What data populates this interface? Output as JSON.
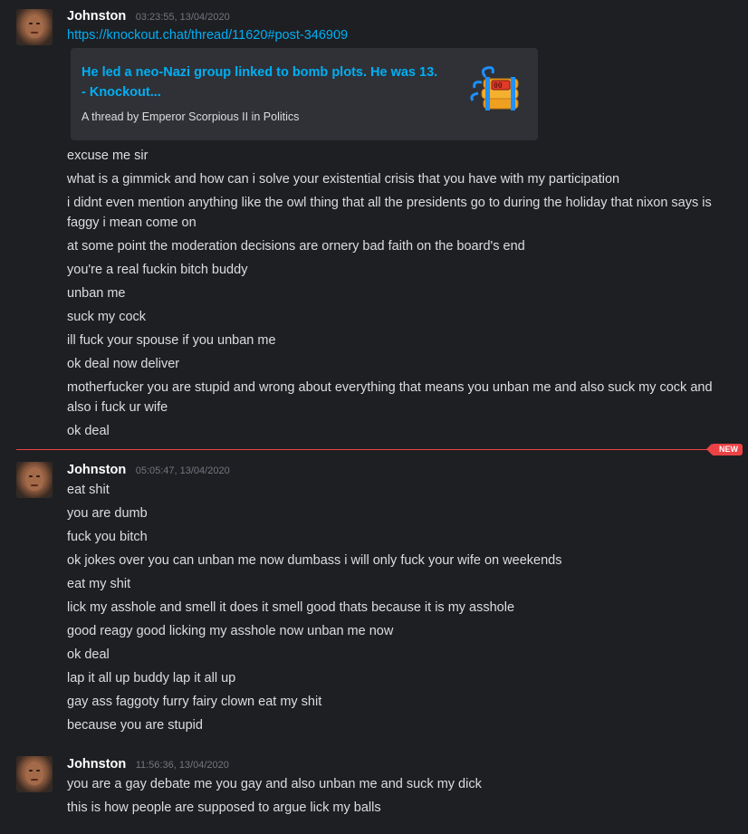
{
  "groups": [
    {
      "username": "Johnston",
      "timestamp": "03:23:55, 13/04/2020",
      "link": "https://knockout.chat/thread/11620#post-346909",
      "embed": {
        "title": "He led a neo-Nazi group linked to bomb plots. He was 13. - Knockout...",
        "description": "A thread by Emperor Scorpious II in Politics",
        "thumbnail_icon": "dynamite-icon"
      },
      "messages": [
        "excuse me sir",
        "what is a gimmick and how can i solve your existential crisis that you have with my participation",
        "i didnt even mention anything like the owl thing that all the presidents go to during the holiday that nixon says is faggy i mean come on",
        "at some point the moderation decisions are ornery bad faith on the board's end",
        "you're a real fuckin bitch buddy",
        "unban me",
        "suck my cock",
        "ill fuck your spouse if you unban me",
        "ok deal now deliver",
        "motherfucker you are stupid and wrong about everything that means you unban me and also suck my cock and also i fuck ur wife",
        "ok deal"
      ]
    },
    {
      "username": "Johnston",
      "timestamp": "05:05:47, 13/04/2020",
      "messages": [
        "eat shit",
        "you are dumb",
        "fuck you bitch",
        "ok jokes over you can unban me now dumbass i will only fuck your wife on weekends",
        "eat my shit",
        "lick my asshole and smell it does it smell good thats because it is my asshole",
        "good reagy good licking my asshole now unban me now",
        "ok deal",
        "lap it all up buddy lap it all up",
        "gay ass faggoty furry fairy clown eat my shit",
        "because you are stupid"
      ]
    },
    {
      "username": "Johnston",
      "timestamp": "11:56:36, 13/04/2020",
      "messages": [
        "you are a gay debate me you gay and also unban me and suck my dick",
        "this is how people are supposed to argue lick my balls"
      ]
    }
  ],
  "new_divider": {
    "label": "NEW",
    "color": "#ed4245"
  },
  "colors": {
    "background": "#1e1f23",
    "link": "#00aff4",
    "embed_bg": "#2f3136",
    "timestamp": "#72767d"
  }
}
